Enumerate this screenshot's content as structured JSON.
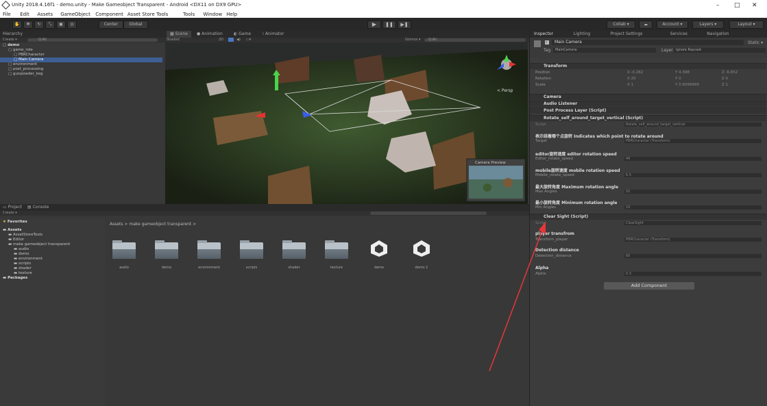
{
  "window": {
    "title": "Unity 2018.4.16f1 - demo.unity - Make Gameobject Transparent - Android <DX11 on DX9 GPU>",
    "min": "–",
    "max": "□",
    "close": "✕"
  },
  "menu": [
    "File",
    "Edit",
    "Assets",
    "GameObject",
    "Component",
    "Asset Store Tools",
    "Tools",
    "Window",
    "Help"
  ],
  "toolbar": {
    "center": "Center",
    "global": "Global",
    "collab": "Collab ▾",
    "account": "Account ▾",
    "layers": "Layers ▾",
    "layout": "Layout ▾"
  },
  "hierarchy": {
    "tab": "Hierarchy",
    "create": "Create ▾",
    "search": "Q:All",
    "items": [
      {
        "label": "demo",
        "indent": 0,
        "sel": false,
        "bold": true
      },
      {
        "label": "game_role",
        "indent": 1,
        "sel": false
      },
      {
        "label": "PBRCharacter",
        "indent": 2,
        "sel": false
      },
      {
        "label": "Main Camera",
        "indent": 2,
        "sel": true
      },
      {
        "label": "environment",
        "indent": 1,
        "sel": false
      },
      {
        "label": "post_processing",
        "indent": 1,
        "sel": false
      },
      {
        "label": "gunpowder_keg",
        "indent": 1,
        "sel": false
      }
    ]
  },
  "scene": {
    "tabs": [
      "Scene",
      "Animation",
      "Game",
      "Animator"
    ],
    "shaded": "Shaded",
    "mode2d": "2D",
    "gizmos": "Gizmos ▾",
    "search": "Q:All",
    "persp": "< Persp",
    "preview": "Camera Preview"
  },
  "project": {
    "tabs": [
      "Project",
      "Console"
    ],
    "create": "Create ▾",
    "breadcrumb": "Assets > make gameobject transparent >",
    "tree": [
      {
        "label": "Favorites",
        "indent": 0,
        "bold": true
      },
      {
        "label": "Assets",
        "indent": 0,
        "bold": true
      },
      {
        "label": "AssetStoreTools",
        "indent": 1
      },
      {
        "label": "Editor",
        "indent": 1
      },
      {
        "label": "make gameobject transparent",
        "indent": 1
      },
      {
        "label": "audio",
        "indent": 2
      },
      {
        "label": "demo",
        "indent": 2
      },
      {
        "label": "environment",
        "indent": 2
      },
      {
        "label": "scripts",
        "indent": 2
      },
      {
        "label": "shader",
        "indent": 2
      },
      {
        "label": "texture",
        "indent": 2
      },
      {
        "label": "Packages",
        "indent": 0,
        "bold": true
      }
    ],
    "assets": [
      {
        "name": "audio",
        "kind": "folder"
      },
      {
        "name": "demo",
        "kind": "folder"
      },
      {
        "name": "environment",
        "kind": "folder"
      },
      {
        "name": "scripts",
        "kind": "folder"
      },
      {
        "name": "shader",
        "kind": "folder"
      },
      {
        "name": "texture",
        "kind": "folder"
      },
      {
        "name": "demo",
        "kind": "unity"
      },
      {
        "name": "demo 1",
        "kind": "unity"
      }
    ]
  },
  "inspector": {
    "tabs": [
      "Inspector",
      "Lighting",
      "Project Settings",
      "Services",
      "Navigation"
    ],
    "object_name": "Main Camera",
    "static": "Static ▾",
    "tag_label": "Tag",
    "tag": "MainCamera",
    "layer_label": "Layer",
    "layer": "Ignore Raycast",
    "transform": {
      "title": "Transform",
      "rows": [
        {
          "label": "Position",
          "x": "X -0.282",
          "y": "Y 4.398",
          "z": "Z -6.852"
        },
        {
          "label": "Rotation",
          "x": "X 20",
          "y": "Y 0",
          "z": "Z 0"
        },
        {
          "label": "Scale",
          "x": "X 1",
          "y": "Y 0.6099999",
          "z": "Z 1"
        }
      ]
    },
    "components": [
      "Camera",
      "Audio Listener",
      "Post Process Layer (Script)"
    ],
    "rotate": {
      "title": "Rotate_self_around_target_vertical (Script)",
      "script_label": "Script",
      "script": "Rotate_self_around_target_vertical",
      "h1": "表示绕着哪个点旋转 Indicates which point to rotate around",
      "target_label": "Target",
      "target": "PBRCharacter (Transform)",
      "h2": "editor旋转速度 editor rotation speed",
      "ers_label": "Editor_rotate_speed",
      "ers": "40",
      "h3": "mobile旋转速度 mobile rotation speed",
      "mrs_label": "Mobile_rotate_speed",
      "mrs": "6.5",
      "h4": "最大旋转角度 Maximum rotation angle",
      "max_label": "Max Angles",
      "max": "50",
      "h5": "最小旋转角度 Minimum rotation angle",
      "min_label": "Min Angles",
      "min": "10"
    },
    "clear": {
      "title": "Clear Sight (Script)",
      "script_label": "Script",
      "script": "ClearSight",
      "h1": "player transfrom",
      "p_label": "Transform_player",
      "p": "PBRCharacter (Transform)",
      "h2": "Detection distance",
      "d_label": "Detection_distance",
      "d": "60",
      "h3": "Alpha",
      "a_label": "Alpha",
      "a": "0.3"
    },
    "add_component": "Add Component"
  },
  "colors": {
    "selection": "#3e5f96",
    "accent_arrow": "#e8353a"
  }
}
